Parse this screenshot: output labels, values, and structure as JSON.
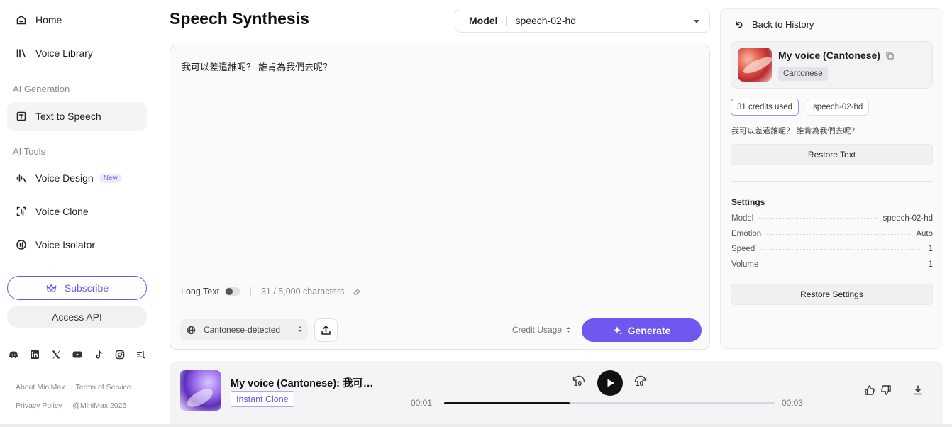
{
  "sidebar": {
    "nav": [
      {
        "label": "Home",
        "icon": "home-icon"
      },
      {
        "label": "Voice Library",
        "icon": "library-icon"
      }
    ],
    "sections": {
      "ai_generation": "AI Generation",
      "ai_tools": "AI Tools"
    },
    "ai_generation_items": [
      {
        "label": "Text to Speech",
        "icon": "text-to-speech-icon",
        "active": true
      }
    ],
    "ai_tools_items": [
      {
        "label": "Voice Design",
        "icon": "voice-design-icon",
        "badge": "New"
      },
      {
        "label": "Voice Clone",
        "icon": "voice-clone-icon"
      },
      {
        "label": "Voice Isolator",
        "icon": "voice-isolator-icon"
      }
    ],
    "subscribe_label": "Subscribe",
    "access_api_label": "Access API",
    "socials": [
      "discord-icon",
      "linkedin-icon",
      "x-icon",
      "youtube-icon",
      "tiktok-icon",
      "instagram-icon",
      "podcast-icon"
    ],
    "footer": {
      "about": "About MiniMax",
      "terms": "Terms of Service",
      "privacy": "Privacy Policy",
      "copyright": "@MiniMax 2025"
    }
  },
  "main": {
    "title": "Speech Synthesis",
    "model_select": {
      "label": "Model",
      "value": "speech-02-hd"
    },
    "editor": {
      "text": "我可以差遣誰呢？ 誰肯為我們去呢？",
      "long_text_label": "Long Text",
      "long_text_enabled": false,
      "char_count": "31 / 5,000 characters"
    },
    "language_select": "Cantonese-detected",
    "credit_usage_label": "Credit Usage",
    "generate_label": "Generate"
  },
  "history_panel": {
    "back_label": "Back to History",
    "voice_name": "My voice (Cantonese)",
    "voice_tag": "Cantonese",
    "credits_chip": "31 credits used",
    "model_chip": "speech-02-hd",
    "text": "我可以差遣誰呢？ 誰肯為我們去呢？",
    "restore_text_label": "Restore Text",
    "settings_title": "Settings",
    "settings": [
      {
        "key": "Model",
        "value": "speech-02-hd"
      },
      {
        "key": "Emotion",
        "value": "Auto"
      },
      {
        "key": "Speed",
        "value": "1"
      },
      {
        "key": "Volume",
        "value": "1"
      }
    ],
    "restore_settings_label": "Restore Settings"
  },
  "player": {
    "title": "My voice (Cantonese): 我可…",
    "tag": "Instant Clone",
    "skip_back": "10",
    "skip_forward": "10",
    "current_time": "00:01",
    "total_time": "00:03",
    "progress": 0.38
  },
  "colors": {
    "accent": "#6f57f0",
    "active_nav_bg": "#f4f4f6"
  }
}
